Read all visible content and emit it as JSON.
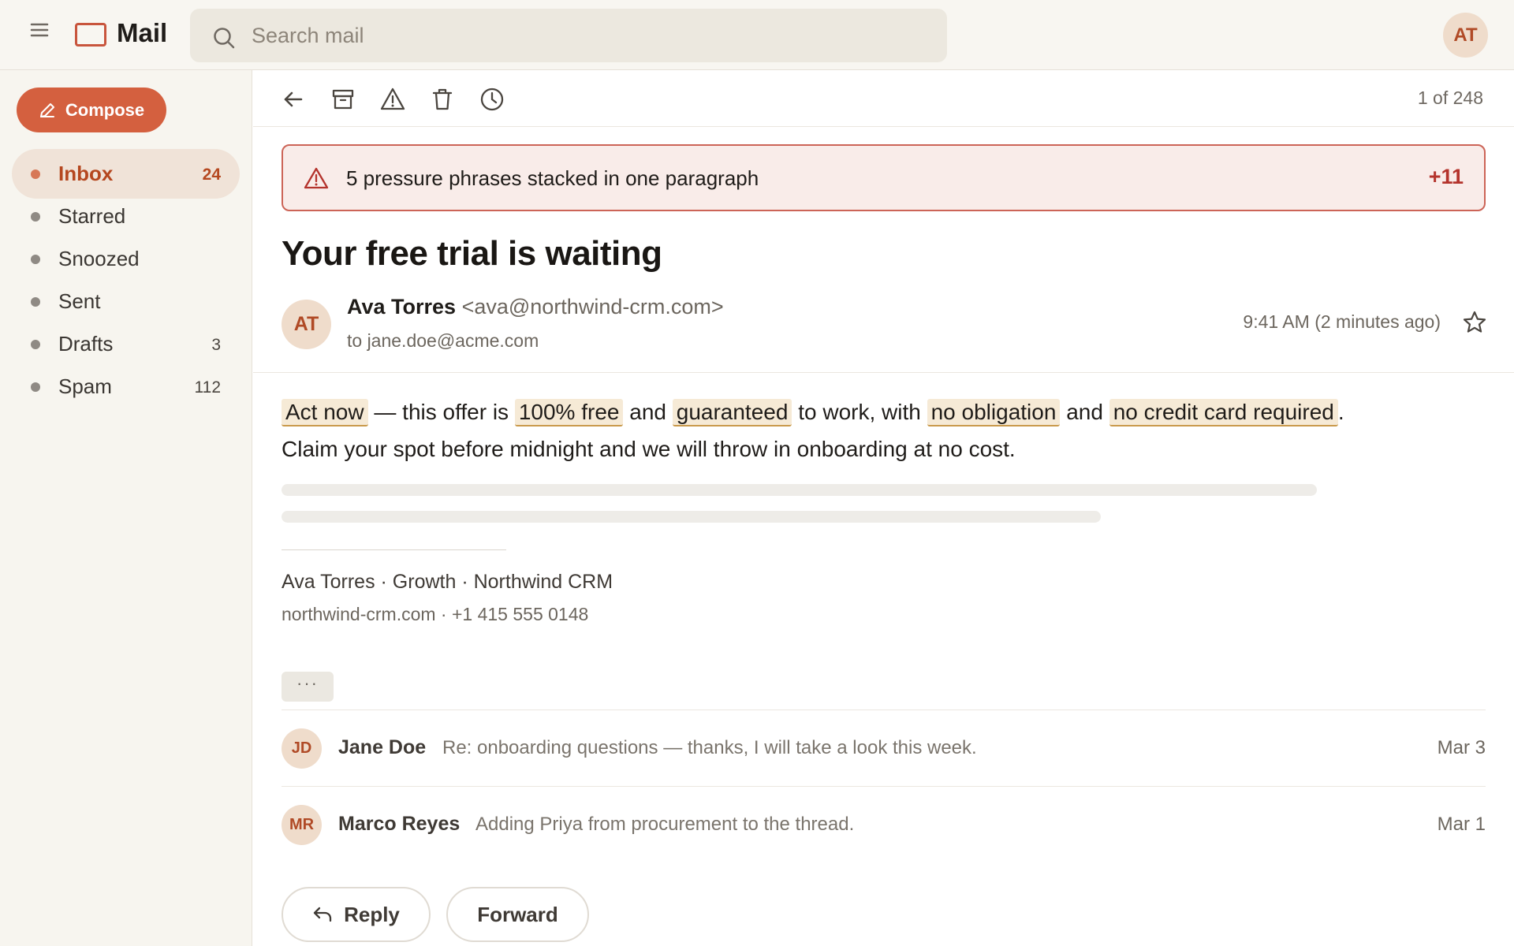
{
  "app": {
    "title": "Mail",
    "logo_icon": "mail-box-icon",
    "brand_color": "#c8553d"
  },
  "search": {
    "placeholder": "Search mail",
    "value": ""
  },
  "user": {
    "initials": "AT"
  },
  "sidebar": {
    "compose_label": "Compose",
    "items": [
      {
        "label": "Inbox",
        "count": "24",
        "active": true
      },
      {
        "label": "Starred",
        "count": ""
      },
      {
        "label": "Snoozed",
        "count": ""
      },
      {
        "label": "Sent",
        "count": ""
      },
      {
        "label": "Drafts",
        "count": "3"
      },
      {
        "label": "Spam",
        "count": "112"
      }
    ]
  },
  "toolbar": {
    "icons": [
      "back-arrow-icon",
      "archive-icon",
      "report-spam-icon",
      "trash-icon",
      "snooze-clock-icon"
    ],
    "pager": "1 of 248"
  },
  "alert": {
    "text": "5 pressure phrases stacked in one paragraph",
    "score": "+11",
    "color": "#b4332c"
  },
  "email": {
    "subject": "Your free trial is waiting",
    "sender": {
      "initials": "AT",
      "name": "Ava Torres",
      "email": "<ava@northwind-crm.com>",
      "to": "to jane.doe@acme.com"
    },
    "time": "9:41 AM (2 minutes ago)",
    "body": {
      "hl1": "Act now",
      "t1": " — this offer is ",
      "hl2": "100% free",
      "t2": " and ",
      "hl3": "guaranteed",
      "t3": " to work, with ",
      "hl4": "no obligation",
      "t4": " and ",
      "hl5": "no credit card required",
      "t5": ". Claim your spot before midnight and we will throw in onboarding at no cost."
    },
    "signature": {
      "line1": "Ava Torres · Growth · Northwind CRM",
      "line2": "northwind-crm.com · +1 415 555 0148"
    },
    "more_label": "···"
  },
  "thread": [
    {
      "initials": "JD",
      "name": "Jane Doe",
      "snippet": "Re: onboarding questions — thanks, I will take a look this week.",
      "date": "Mar 3"
    },
    {
      "initials": "MR",
      "name": "Marco Reyes",
      "snippet": "Adding Priya from procurement to the thread.",
      "date": "Mar 1"
    }
  ],
  "actions": {
    "reply_label": "Reply",
    "forward_label": "Forward"
  }
}
